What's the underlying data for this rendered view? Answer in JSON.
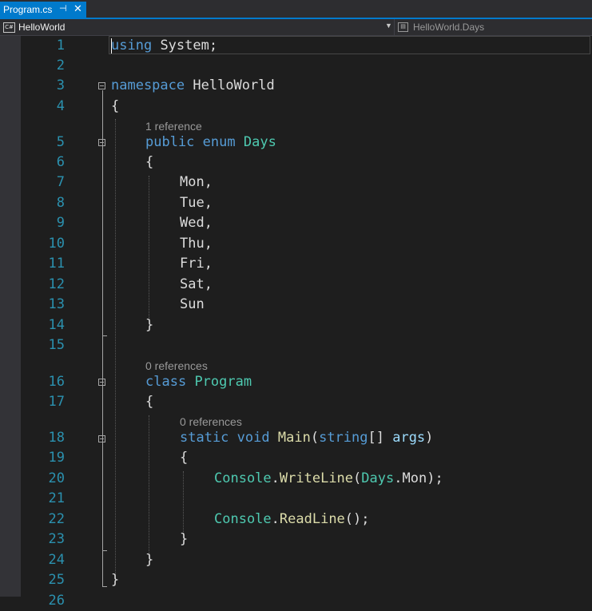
{
  "tab": {
    "label": "Program.cs",
    "pin_glyph": "⊣",
    "close_glyph": "✕"
  },
  "navbar": {
    "project": "HelloWorld",
    "project_icon": "C#",
    "member": "HelloWorld.Days"
  },
  "colors": {
    "keyword": "#569cd6",
    "type": "#4ec9b0",
    "method": "#dcdcaa",
    "parameter": "#9cdcfe",
    "text": "#dcdcdc",
    "line_number": "#2b91af",
    "accent": "#007acc"
  },
  "lens": {
    "enum_refs": "1 reference",
    "class_refs": "0 references",
    "method_refs": "0 references"
  },
  "lines": {
    "n1": "1",
    "n2": "2",
    "n3": "3",
    "n4": "4",
    "n5": "5",
    "n6": "6",
    "n7": "7",
    "n8": "8",
    "n9": "9",
    "n10": "10",
    "n11": "11",
    "n12": "12",
    "n13": "13",
    "n14": "14",
    "n15": "15",
    "n16": "16",
    "n17": "17",
    "n18": "18",
    "n19": "19",
    "n20": "20",
    "n21": "21",
    "n22": "22",
    "n23": "23",
    "n24": "24",
    "n25": "25",
    "n26": "26"
  },
  "tokens": {
    "using": "using",
    "system": "System;",
    "namespace": "namespace",
    "ns_name": "HelloWorld",
    "open_brace": "{",
    "close_brace": "}",
    "public": "public",
    "enum": "enum",
    "days": "Days",
    "mon": "Mon,",
    "tue": "Tue,",
    "wed": "Wed,",
    "thu": "Thu,",
    "fri": "Fri,",
    "sat": "Sat,",
    "sun": "Sun",
    "class": "class",
    "program": "Program",
    "static": "static",
    "void": "void",
    "main": "Main",
    "paren_open": "(",
    "string": "string",
    "brackets": "[] ",
    "args": "args",
    "paren_close": ")",
    "console": "Console",
    "dot": ".",
    "writeline": "WriteLine",
    "days_ref": "Days",
    "mon_ref": "Mon",
    "end_call": ");",
    "readline": "ReadLine",
    "empty_call": "();"
  }
}
